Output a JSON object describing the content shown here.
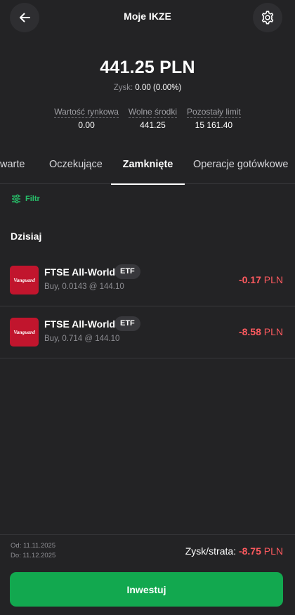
{
  "header": {
    "title": "Moje IKZE",
    "back_icon": "arrow-left-icon",
    "settings_icon": "gear-icon"
  },
  "summary": {
    "balance": "441.25 PLN",
    "zysk_label": "Zysk:",
    "zysk_value": "0.00 (0.00%)"
  },
  "stats": [
    {
      "label": "Wartość rynkowa",
      "value": "0.00"
    },
    {
      "label": "Wolne środki",
      "value": "441.25"
    },
    {
      "label": "Pozostały limit",
      "value": "15 161.40"
    }
  ],
  "tabs": [
    {
      "label": "Otwarte",
      "visible_text": "warte"
    },
    {
      "label": "Oczekujące"
    },
    {
      "label": "Zamknięte",
      "active": true
    },
    {
      "label": "Operacje gotówkowe"
    }
  ],
  "filter": {
    "label": "Filtr",
    "icon": "sliders-icon"
  },
  "section": {
    "title": "Dzisiaj"
  },
  "transactions": [
    {
      "logo_text": "Vanguard",
      "name": "FTSE All-World",
      "badge": "ETF",
      "details": "Buy, 0.0143 @ 144.10",
      "amount": "-0.17",
      "currency": "PLN"
    },
    {
      "logo_text": "Vanguard",
      "name": "FTSE All-World",
      "badge": "ETF",
      "details": "Buy, 0.714 @ 144.10",
      "amount": "-8.58",
      "currency": "PLN"
    }
  ],
  "footer": {
    "date_from": "Od: 11.11.2025",
    "date_to": "Do: 11.12.2025",
    "total_label": "Zysk/strata:",
    "total_value": "-8.75",
    "total_currency": "PLN",
    "invest_button": "Inwestuj"
  },
  "colors": {
    "background": "#232325",
    "accent_green": "#27c06a",
    "button_green": "#12a84f",
    "negative_red": "#ff5a5f",
    "vanguard_red": "#c1152d"
  }
}
